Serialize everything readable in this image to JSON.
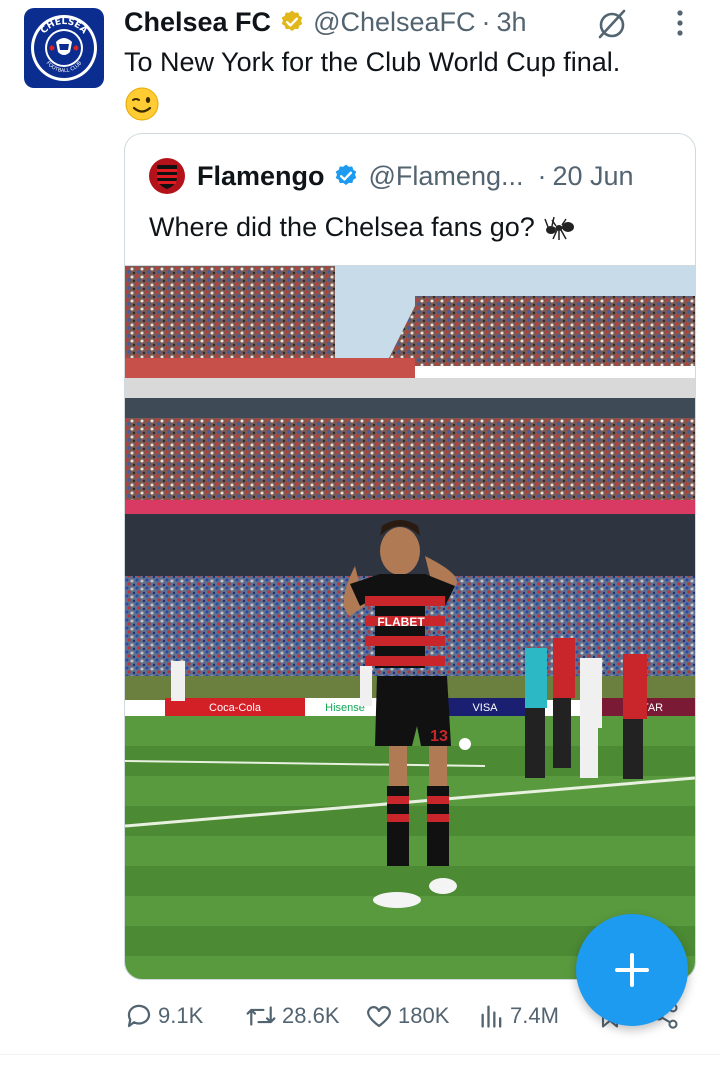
{
  "tweet": {
    "author_name": "Chelsea FC",
    "handle": "@ChelseaFC",
    "separator": "·",
    "time": "3h",
    "text": "To New York for the Club World Cup final.",
    "emoji": "😉",
    "avatar_text_top": "CHELSEA",
    "avatar_text_bottom": "FOOTBALL CLUB"
  },
  "quoted": {
    "author_name": "Flamengo",
    "handle": "@Flameng...",
    "separator": "·",
    "date": "20 Jun",
    "text": "Where did the Chelsea fans go?",
    "photo": {
      "ad_boards": [
        "Coca-Cola",
        "Hisense",
        "VISA",
        "QATAR"
      ],
      "shirt_sponsor": "FLABET",
      "shirt_number": "13"
    }
  },
  "actions": {
    "replies": "9.1K",
    "reposts": "28.6K",
    "likes": "180K",
    "views": "7.4M"
  },
  "colors": {
    "accent": "#1d9bf0",
    "verified_gold": "#e2b719",
    "verified_blue": "#1d9bf0",
    "secondary_text": "#536471",
    "chelsea_blue": "#0a2d8f",
    "flamengo_red": "#b3121b"
  },
  "icons": {
    "verified_gold": "verified-gold-badge-icon",
    "verified_blue": "verified-blue-badge-icon",
    "grok": "grok-icon",
    "more": "more-vertical-icon",
    "reply": "reply-icon",
    "repost": "repost-icon",
    "like": "heart-icon",
    "views": "views-chart-icon",
    "compose": "plus-icon"
  }
}
